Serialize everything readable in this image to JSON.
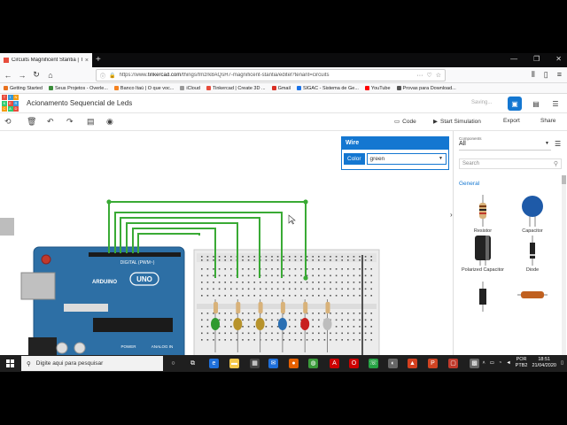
{
  "browser": {
    "tab_title": "Circuits Magnificent Stantia | Ti",
    "url_prefix": "https://www.",
    "url_domain": "tinkercad.com",
    "url_rest": "/things/fmzrk8AQsH7-magnificent-stantia/editel?tenant=circuits",
    "bookmarks": [
      {
        "label": "Getting Started",
        "color": "#e8711e"
      },
      {
        "label": "Seus Projetos - Overle...",
        "color": "#3a8d3a"
      },
      {
        "label": "Banco Itaú | O que voc...",
        "color": "#f58220"
      },
      {
        "label": "iCloud",
        "color": "#999999"
      },
      {
        "label": "Tinkercad | Create 3D ...",
        "color": "#e74c3c"
      },
      {
        "label": "Gmail",
        "color": "#d93025"
      },
      {
        "label": "SIGAC - Sistema de Ge...",
        "color": "#1a73e8"
      },
      {
        "label": "YouTube",
        "color": "#ff0000"
      },
      {
        "label": "Provas para Download...",
        "color": "#555555"
      }
    ]
  },
  "app": {
    "logo_letters": [
      "T",
      "I",
      "N",
      "K",
      "E",
      "R",
      "C",
      "A",
      "D"
    ],
    "design_title": "Acionamento Sequencial de Leds",
    "saving_text": "Saving...",
    "code_label": "Code",
    "sim_label": "Start Simulation",
    "export_label": "Export",
    "share_label": "Share"
  },
  "inspector": {
    "title": "Wire",
    "color_label": "Color",
    "color_value": "green"
  },
  "components": {
    "filter_label": "Components",
    "filter_value": "All",
    "search_placeholder": "Search",
    "section": "General",
    "items": [
      {
        "label": "Resistor"
      },
      {
        "label": "Capacitor"
      },
      {
        "label": "Polarized Capacitor"
      },
      {
        "label": "Diode"
      },
      {
        "label": ""
      },
      {
        "label": ""
      }
    ]
  },
  "board": {
    "digital_label": "DIGITAL (PWM~)",
    "brand": "ARDUINO",
    "model": "UNO",
    "power_label": "POWER",
    "analog_label": "ANALOG IN"
  },
  "taskbar": {
    "search_placeholder": "Digite aqui para pesquisar",
    "lang_top": "POR",
    "lang_bottom": "PTB2",
    "time": "18:51",
    "date": "21/04/2020"
  },
  "colors": {
    "accent": "#1477d1",
    "wire": "#3aaa35",
    "arduino": "#2d6fa5",
    "led_colors": [
      "#2e9a2e",
      "#b7932c",
      "#b7932c",
      "#2a6fb3",
      "#c81f1f",
      "#bdbdbd"
    ]
  }
}
